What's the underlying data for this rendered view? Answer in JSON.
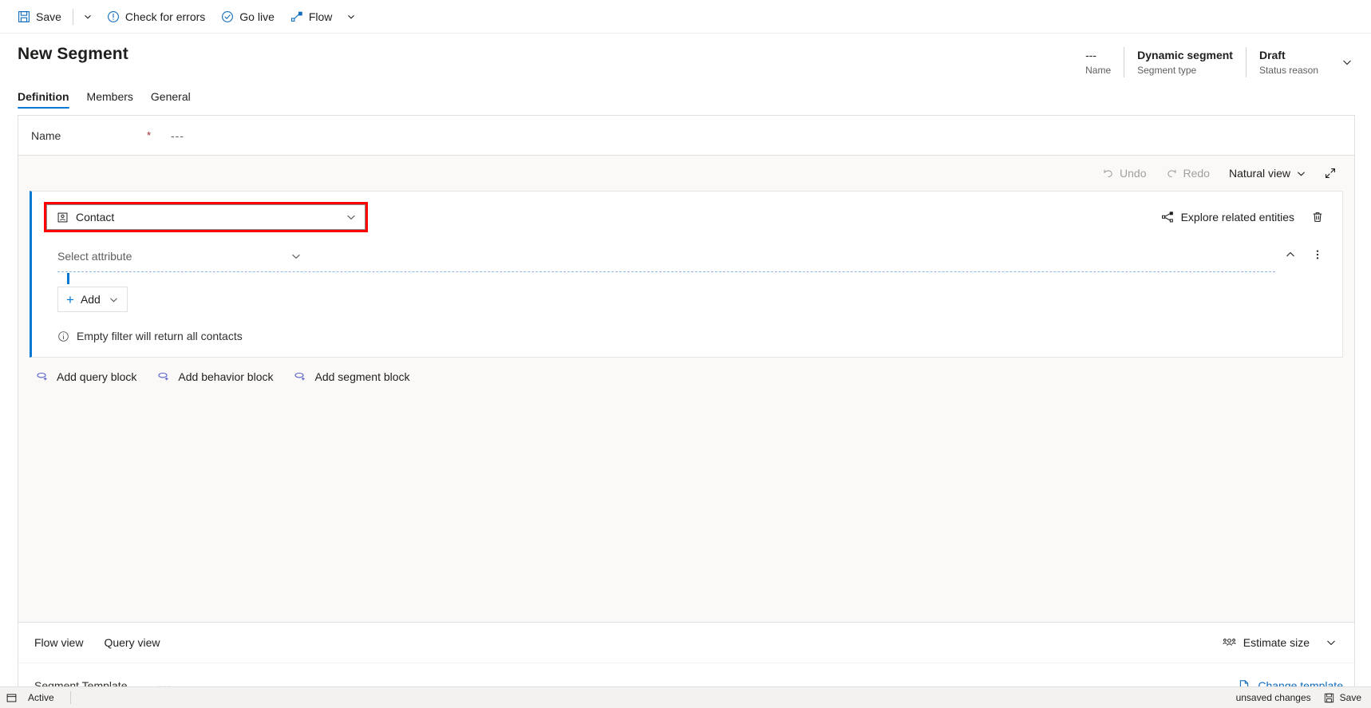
{
  "commandbar": {
    "items": [
      {
        "label": "Save",
        "icon": "save-icon"
      },
      {
        "label": "Check for errors",
        "icon": "error-circle-icon"
      },
      {
        "label": "Go live",
        "icon": "checkmark-circle-icon"
      },
      {
        "label": "Flow",
        "icon": "flow-icon"
      }
    ],
    "save_caret": "chevron-down-icon",
    "flow_caret": "chevron-down-icon"
  },
  "header": {
    "title": "New Segment",
    "fields": [
      {
        "value": "---",
        "label": "Name",
        "bold": false
      },
      {
        "value": "Dynamic segment",
        "label": "Segment type",
        "bold": true
      },
      {
        "value": "Draft",
        "label": "Status reason",
        "bold": true
      }
    ],
    "expand_icon": "chevron-down-icon"
  },
  "tabs": [
    {
      "label": "Definition",
      "active": true
    },
    {
      "label": "Members",
      "active": false
    },
    {
      "label": "General",
      "active": false
    }
  ],
  "form": {
    "name_label": "Name",
    "required_marker": "*",
    "name_value": "---"
  },
  "canvas_toolbar": {
    "undo": "Undo",
    "redo": "Redo",
    "view_mode": "Natural view",
    "view_caret": "chevron-down-icon",
    "expand": "expand-icon"
  },
  "query_block": {
    "entity": "Contact",
    "entity_icon": "contact-icon",
    "entity_caret": "chevron-down-icon",
    "explore_label": "Explore related entities",
    "explore_icon": "share-nodes-icon",
    "delete_icon": "trash-icon",
    "attribute_placeholder": "Select attribute",
    "attribute_caret": "chevron-down-icon",
    "collapse_icon": "chevron-up-icon",
    "more_icon": "more-vertical-icon",
    "add_label": "Add",
    "add_plus": "plus-icon",
    "add_caret": "chevron-down-icon",
    "empty_note": "Empty filter will return all contacts",
    "info_icon": "info-icon"
  },
  "block_links": [
    {
      "label": "Add query block",
      "icon": "add-block-icon"
    },
    {
      "label": "Add behavior block",
      "icon": "add-block-icon"
    },
    {
      "label": "Add segment block",
      "icon": "add-block-icon"
    }
  ],
  "footer": {
    "views": [
      {
        "label": "Flow view"
      },
      {
        "label": "Query view"
      }
    ],
    "estimate_label": "Estimate size",
    "estimate_icon": "people-icon",
    "estimate_caret": "chevron-down-icon",
    "template_label": "Segment Template",
    "template_value": "---",
    "change_template_label": "Change template",
    "change_template_icon": "document-icon"
  },
  "statusbar": {
    "dock_icon": "dock-icon",
    "state": "Active",
    "unsaved": "unsaved changes",
    "save_label": "Save",
    "save_icon": "save-icon"
  },
  "colors": {
    "accent": "#0078d4",
    "highlight": "#ff0000",
    "link": "#0f6cbd",
    "required": "#a4262c",
    "canvas_bg": "#faf9f8"
  }
}
